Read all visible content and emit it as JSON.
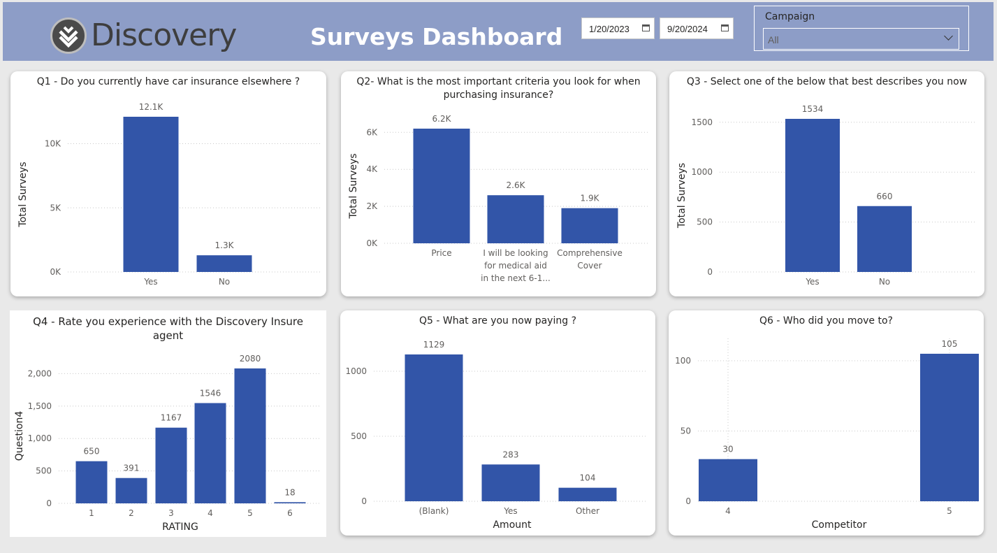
{
  "header": {
    "logo_text": "Discovery",
    "title": "Surveys Dashboard",
    "date_start": "1/20/2023",
    "date_end": "9/20/2024",
    "campaign_label": "Campaign",
    "campaign_value": "All"
  },
  "colors": {
    "bar": "#3255a8",
    "header": "#8d9dc7",
    "grid": "#c8c8c8"
  },
  "chart_data": [
    {
      "id": "q1",
      "type": "bar",
      "title": "Q1 - Do you currently have car insurance elsewhere ?",
      "xlabel": "",
      "ylabel": "Total Surveys",
      "categories": [
        "Yes",
        "No"
      ],
      "values": [
        12100,
        1300
      ],
      "data_labels": [
        "12.1K",
        "1.3K"
      ],
      "yticks": [
        0,
        5000,
        10000
      ],
      "ytick_labels": [
        "0K",
        "5K",
        "10K"
      ],
      "ylim": [
        0,
        12100
      ]
    },
    {
      "id": "q2",
      "type": "bar",
      "title": "Q2- What is the most important criteria you look for when purchasing insurance?",
      "xlabel": "",
      "ylabel": "Total Surveys",
      "categories": [
        "Price",
        "I will be looking for medical aid in the next 6-1...",
        "Comprehensive Cover"
      ],
      "category_lines": [
        [
          "Price"
        ],
        [
          "I will be looking",
          "for medical aid",
          "in the next 6-1..."
        ],
        [
          "Comprehensive",
          "Cover"
        ]
      ],
      "values": [
        6200,
        2600,
        1900
      ],
      "data_labels": [
        "6.2K",
        "2.6K",
        "1.9K"
      ],
      "yticks": [
        0,
        2000,
        4000,
        6000
      ],
      "ytick_labels": [
        "0K",
        "2K",
        "4K",
        "6K"
      ],
      "ylim": [
        0,
        6200
      ]
    },
    {
      "id": "q3",
      "type": "bar",
      "title": "Q3 - Select one of the below that best describes you now",
      "xlabel": "",
      "ylabel": "Total Surveys",
      "categories": [
        "Yes",
        "No"
      ],
      "values": [
        1534,
        660
      ],
      "data_labels": [
        "1534",
        "660"
      ],
      "yticks": [
        0,
        500,
        1000,
        1500
      ],
      "ytick_labels": [
        "0",
        "500",
        "1000",
        "1500"
      ],
      "ylim": [
        0,
        1534
      ]
    },
    {
      "id": "q4",
      "type": "bar",
      "title": "Q4 - Rate you experience with the Discovery Insure agent",
      "xlabel": "RATING",
      "ylabel": "Question4",
      "categories": [
        "1",
        "2",
        "3",
        "4",
        "5",
        "6"
      ],
      "values": [
        650,
        391,
        1167,
        1546,
        2080,
        18
      ],
      "data_labels": [
        "650",
        "391",
        "1167",
        "1546",
        "2080",
        "18"
      ],
      "yticks": [
        0,
        500,
        1000,
        1500,
        2000
      ],
      "ytick_labels": [
        "0",
        "500",
        "1,000",
        "1,500",
        "2,000"
      ],
      "ylim": [
        0,
        2080
      ]
    },
    {
      "id": "q5",
      "type": "bar",
      "title": "Q5 - What are you now paying ?",
      "xlabel": "Amount",
      "ylabel": "",
      "categories": [
        "(Blank)",
        "Yes",
        "Other"
      ],
      "values": [
        1129,
        283,
        104
      ],
      "data_labels": [
        "1129",
        "283",
        "104"
      ],
      "yticks": [
        0,
        500,
        1000
      ],
      "ytick_labels": [
        "0",
        "500",
        "1000"
      ],
      "ylim": [
        0,
        1129
      ]
    },
    {
      "id": "q6",
      "type": "bar",
      "title": "Q6 - Who did you move to?",
      "xlabel": "Competitor",
      "ylabel": "",
      "categories": [
        "4",
        "5"
      ],
      "x": [
        4,
        5
      ],
      "values": [
        30,
        105
      ],
      "data_labels": [
        "30",
        "105"
      ],
      "yticks": [
        0,
        50,
        100
      ],
      "ytick_labels": [
        "0",
        "50",
        "100"
      ],
      "ylim": [
        0,
        105
      ]
    }
  ]
}
